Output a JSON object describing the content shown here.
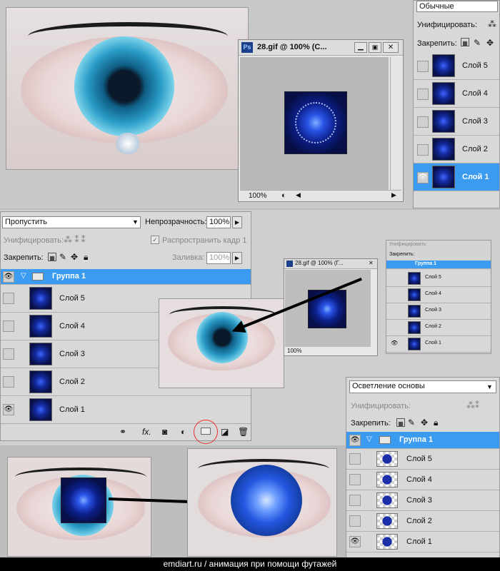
{
  "top_layers_panel": {
    "blend_mode": "Обычные",
    "unify_label": "Унифицировать:",
    "lock_label": "Закрепить:",
    "layers": [
      {
        "name": "Слой 5",
        "visible": false,
        "selected": false
      },
      {
        "name": "Слой 4",
        "visible": false,
        "selected": false
      },
      {
        "name": "Слой 3",
        "visible": false,
        "selected": false
      },
      {
        "name": "Слой 2",
        "visible": false,
        "selected": false
      },
      {
        "name": "Слой 1",
        "visible": true,
        "selected": true
      }
    ]
  },
  "gif_window_large": {
    "title": "28.gif @ 100% (С...",
    "zoom": "100%",
    "app_badge": "Ps"
  },
  "gif_window_small": {
    "title": "28.gif @ 100% (Г...",
    "zoom": "100%"
  },
  "main_layers_panel": {
    "blend_mode": "Пропустить",
    "opacity_label": "Непрозрачность:",
    "opacity_value": "100%",
    "unify_label": "Унифицировать:",
    "propagate_label": "Распространить кадр 1",
    "lock_label": "Закрепить:",
    "fill_label": "Заливка:",
    "fill_value": "100%",
    "group_name": "Группа 1",
    "layers": [
      {
        "name": "Слой 5",
        "visible": false
      },
      {
        "name": "Слой 4",
        "visible": false
      },
      {
        "name": "Слой 3",
        "visible": false
      },
      {
        "name": "Слой 2",
        "visible": false
      },
      {
        "name": "Слой 1",
        "visible": true
      }
    ]
  },
  "mini_layers_panel": {
    "unify_label": "Унифицировать:",
    "lock_label": "Закрепить:",
    "group_name": "Группа 1",
    "layers": [
      "Слой 5",
      "Слой 4",
      "Слой 3",
      "Слой 2",
      "Слой 1"
    ]
  },
  "bottom_layers_panel": {
    "blend_mode": "Осветление основы",
    "unify_label": "Унифицировать:",
    "lock_label": "Закрепить:",
    "group_name": "Группа 1",
    "layers": [
      {
        "name": "Слой 5",
        "visible": false
      },
      {
        "name": "Слой 4",
        "visible": false
      },
      {
        "name": "Слой 3",
        "visible": false
      },
      {
        "name": "Слой 2",
        "visible": false
      },
      {
        "name": "Слой 1",
        "visible": true
      }
    ]
  },
  "footer": {
    "caption": "emdiart.ru / анимация при помощи футажей"
  },
  "colors": {
    "selection": "#3b9bf0",
    "highlight_circle": "#e53030"
  },
  "icons": [
    "eye-icon",
    "folder-icon",
    "link-icon",
    "fx-icon",
    "mask-icon",
    "adjustment-icon",
    "new-group-icon",
    "new-layer-icon",
    "trash-icon",
    "lock-icon",
    "brush-icon",
    "move-icon"
  ]
}
